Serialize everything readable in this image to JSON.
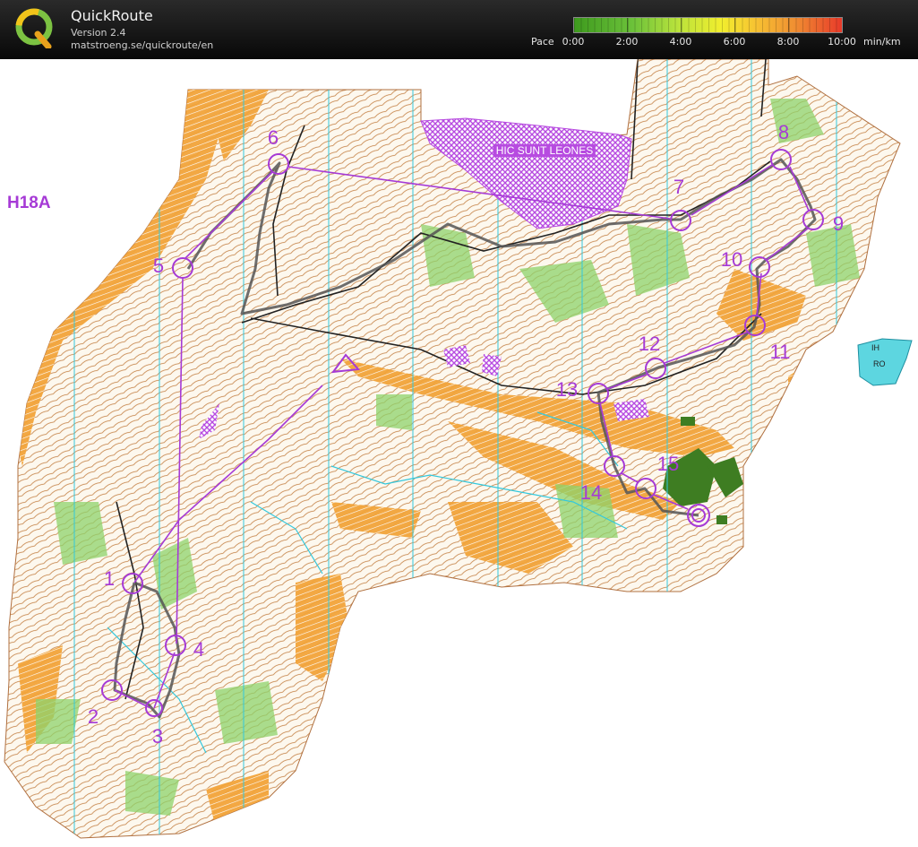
{
  "header": {
    "app_name": "QuickRoute",
    "version": "Version 2.4",
    "url": "matstroeng.se/quickroute/en",
    "pace_title": "Pace",
    "pace_ticks": [
      "0:00",
      "2:00",
      "4:00",
      "6:00",
      "8:00",
      "10:00"
    ],
    "pace_unit": "min/km"
  },
  "map": {
    "class_label": "H18A",
    "restricted_area_label": "HIC SUNT LEONES",
    "inset_labels": [
      "IH",
      "RO"
    ],
    "controls": [
      "1",
      "2",
      "3",
      "4",
      "5",
      "6",
      "7",
      "8",
      "9",
      "10",
      "11",
      "12",
      "13",
      "14",
      "15"
    ],
    "colors": {
      "course": "#a63ad6",
      "route": "#555555",
      "open_land": "#f2a43a",
      "vegetation": "#8ed36b",
      "water": "#33c8dd"
    }
  }
}
